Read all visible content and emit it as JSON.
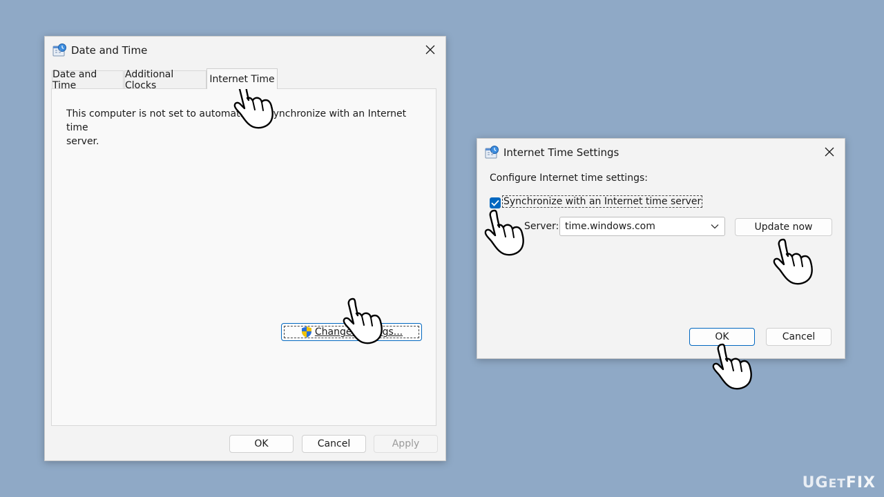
{
  "dialog_main": {
    "title": "Date and Time",
    "tabs": [
      {
        "label": "Date and Time",
        "active": false
      },
      {
        "label": "Additional Clocks",
        "active": false
      },
      {
        "label": "Internet Time",
        "active": true
      }
    ],
    "message_line1": "This computer is not set to automatica",
    "message_hidden": "lly s",
    "message_line1_end": "ynchronize with an Internet time",
    "message_line2": "server.",
    "change_settings_label": "Change settings...",
    "ok_label": "OK",
    "cancel_label": "Cancel",
    "apply_label": "Apply"
  },
  "dialog_settings": {
    "title": "Internet Time Settings",
    "configure_label": "Configure Internet time settings:",
    "sync_label": "Synchronize with an Internet time server",
    "sync_checked": true,
    "server_label": "Server:",
    "server_value": "time.windows.com",
    "update_now_label": "Update now",
    "ok_label": "OK",
    "cancel_label": "Cancel"
  },
  "colors": {
    "background": "#8fa9c6",
    "accent": "#0067c0",
    "dialog": "#f3f3f3"
  },
  "icons": [
    "clock-globe-icon",
    "close-icon",
    "uac-shield-icon",
    "chevron-down-icon",
    "checkmark-icon",
    "pointer-hand-icon"
  ],
  "watermark": {
    "prefix": "UG",
    "middle": "ET",
    "suffix": "FIX"
  }
}
